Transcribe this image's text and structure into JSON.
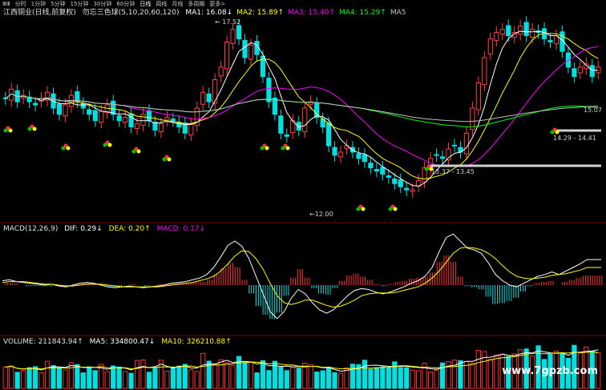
{
  "toolbar": {
    "items": [
      "ⅢⅢ",
      "分时",
      "1分钟",
      "5分钟",
      "15分钟",
      "30分钟",
      "60分钟",
      "日线",
      "周线",
      "月线",
      "多周期",
      "更多>"
    ],
    "active_index": 7
  },
  "price_panel": {
    "title": "江西铜业(日线,前复权)",
    "indicator_name": "勿忘三色球(5,10,20,60,120)",
    "ma": [
      {
        "label": "MA1:",
        "value": "16.08",
        "arrow": "↓",
        "color": "#ffffff"
      },
      {
        "label": "MA2:",
        "value": "15.89",
        "arrow": "↑",
        "color": "#ffff00"
      },
      {
        "label": "MA3:",
        "value": "15.40",
        "arrow": "↑",
        "color": "#ff00ff"
      },
      {
        "label": "MA4:",
        "value": "15.29",
        "arrow": "↑",
        "color": "#00ff00"
      },
      {
        "label": "MA5",
        "value": "",
        "arrow": "",
        "color": "#c0c0c0"
      }
    ],
    "annotations": {
      "high": "17.52",
      "low": "12.00",
      "range_left": "13.37 - 13.45",
      "range_right": "14.29 - 14.41",
      "right_value": "15.07"
    }
  },
  "macd_panel": {
    "title": "MACD(12,26,9)",
    "dif": "DIF: 0.29↓",
    "dea": "DEA: 0.20↑",
    "macd": "MACD: 0.17↓"
  },
  "volume_panel": {
    "title": "VOLUME: 211843.94↑",
    "ma5": "MA5: 334800.47↓",
    "ma10": "MA10: 326210.88↑"
  },
  "watermark": "www.7gpzb.com",
  "chart_data": {
    "type": "candlestick",
    "y_range": [
      12.0,
      17.52
    ],
    "close": [
      15.1,
      15.4,
      15.0,
      15.2,
      15.0,
      14.9,
      15.1,
      15.3,
      14.8,
      14.6,
      14.9,
      15.2,
      15.0,
      14.8,
      14.6,
      14.4,
      14.7,
      14.9,
      14.6,
      14.4,
      14.5,
      14.2,
      14.3,
      14.6,
      14.4,
      14.1,
      14.3,
      14.5,
      14.4,
      14.2,
      14.0,
      14.3,
      14.8,
      15.3,
      15.0,
      15.7,
      16.1,
      16.9,
      17.3,
      17.0,
      16.4,
      16.8,
      16.5,
      15.8,
      15.0,
      14.6,
      14.0,
      13.9,
      14.4,
      14.1,
      14.8,
      15.0,
      14.5,
      14.2,
      13.6,
      13.3,
      13.4,
      13.6,
      13.4,
      13.2,
      13.1,
      12.9,
      12.8,
      12.7,
      12.6,
      12.4,
      12.3,
      12.2,
      12.2,
      12.5,
      12.9,
      13.2,
      13.3,
      13.2,
      13.5,
      13.6,
      13.4,
      14.0,
      14.8,
      15.6,
      16.4,
      17.0,
      17.2,
      17.3,
      17.1,
      17.2,
      17.4,
      17.1,
      17.3,
      17.2,
      17.0,
      16.9,
      17.1,
      16.6,
      16.1,
      15.8,
      16.1,
      16.2,
      15.8,
      16.1
    ],
    "macd_dif": [
      0.05,
      0.06,
      0.04,
      0.03,
      0.02,
      0.01,
      0.0,
      0.01,
      -0.01,
      -0.02,
      0.0,
      0.02,
      0.03,
      0.02,
      0.0,
      -0.02,
      -0.03,
      -0.02,
      -0.01,
      -0.02,
      -0.03,
      -0.02,
      -0.01,
      0.0,
      0.02,
      0.03,
      0.04,
      0.06,
      0.08,
      0.12,
      0.2,
      0.32,
      0.45,
      0.5,
      0.44,
      0.3,
      0.1,
      -0.1,
      -0.3,
      -0.38,
      -0.3,
      -0.15,
      -0.05,
      -0.1,
      -0.2,
      -0.28,
      -0.32,
      -0.28,
      -0.2,
      -0.12,
      -0.06,
      -0.04,
      -0.05,
      -0.08,
      -0.1,
      -0.08,
      -0.05,
      -0.02,
      0.02,
      0.05,
      0.1,
      0.2,
      0.38,
      0.54,
      0.58,
      0.5,
      0.42,
      0.4,
      0.36,
      0.25,
      0.12,
      0.05,
      0.0,
      -0.02,
      0.02,
      0.06,
      0.1,
      0.12,
      0.15,
      0.12,
      0.16,
      0.2,
      0.24,
      0.29,
      0.29,
      0.29
    ],
    "macd_dea": [
      0.03,
      0.04,
      0.04,
      0.04,
      0.03,
      0.02,
      0.01,
      0.01,
      0.0,
      -0.01,
      -0.01,
      0.0,
      0.01,
      0.01,
      0.01,
      0.0,
      -0.01,
      -0.02,
      -0.02,
      -0.02,
      -0.02,
      -0.02,
      -0.02,
      -0.01,
      0.0,
      0.01,
      0.02,
      0.03,
      0.05,
      0.07,
      0.1,
      0.16,
      0.24,
      0.33,
      0.39,
      0.38,
      0.3,
      0.18,
      0.02,
      -0.12,
      -0.2,
      -0.22,
      -0.2,
      -0.17,
      -0.17,
      -0.2,
      -0.23,
      -0.25,
      -0.24,
      -0.21,
      -0.17,
      -0.12,
      -0.1,
      -0.09,
      -0.09,
      -0.09,
      -0.08,
      -0.06,
      -0.04,
      -0.02,
      0.02,
      0.08,
      0.16,
      0.26,
      0.36,
      0.42,
      0.43,
      0.42,
      0.4,
      0.36,
      0.3,
      0.22,
      0.15,
      0.1,
      0.08,
      0.07,
      0.08,
      0.09,
      0.11,
      0.12,
      0.13,
      0.15,
      0.17,
      0.2,
      0.2,
      0.2
    ],
    "volume_ma5": 334800.47,
    "volume_ma10": 326210.88,
    "volume_last": 211843.94
  }
}
